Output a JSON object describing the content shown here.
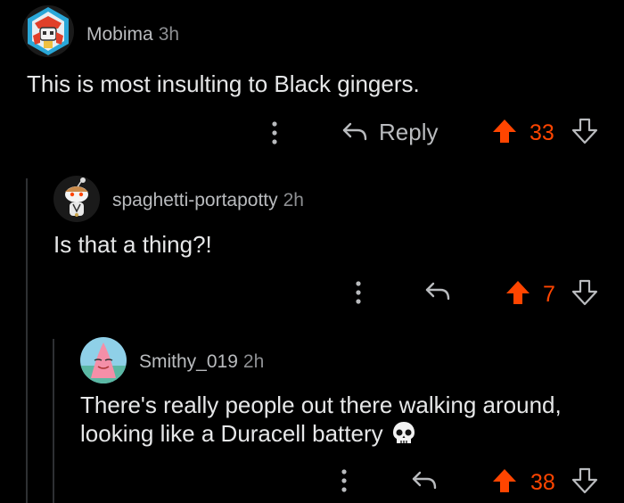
{
  "comments": [
    {
      "username": "Mobima",
      "time": "3h",
      "text": "This is most insulting to Black gingers.",
      "reply_label": "Reply",
      "votes": "33",
      "avatar_icon": "robot-avatar-icon"
    },
    {
      "username": "spaghetti-portapotty",
      "time": "2h",
      "text": "Is that a thing?!",
      "votes": "7",
      "avatar_icon": "snoo-avatar-icon"
    },
    {
      "username": "Smithy_019",
      "time": "2h",
      "text_line1": "There's really people out there walking around,",
      "text_line2": "looking like a Duracell battery",
      "emoji": "skull-emoji",
      "votes": "38",
      "avatar_icon": "patrick-avatar-icon"
    }
  ],
  "colors": {
    "upvote": "#ff4500",
    "background": "#000000",
    "muted": "#b9bbbe"
  }
}
